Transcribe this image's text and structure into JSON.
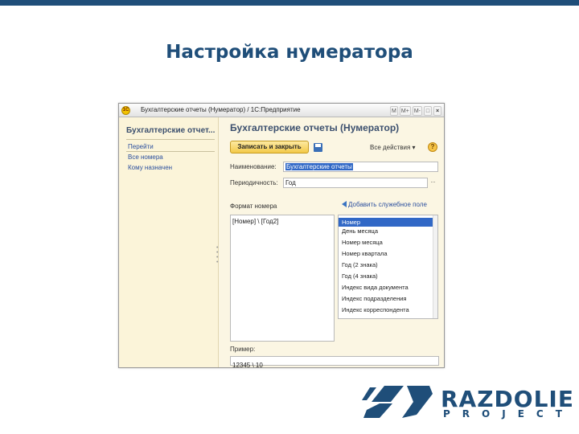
{
  "slide": {
    "title": "Настройка нумератора"
  },
  "window": {
    "title": "Бухгалтерские отчеты (Нумератор) / 1С:Предприятие",
    "app_icon_text": "1С",
    "toolbar": [
      "M",
      "M+",
      "M-",
      "□",
      "×"
    ]
  },
  "sidebar": {
    "heading": "Бухгалтерские отчет...",
    "links": [
      "Перейти",
      "Все номера",
      "Кому назначен"
    ]
  },
  "form": {
    "title": "Бухгалтерские отчеты (Нумератор)",
    "save_close_label": "Записать и закрыть",
    "actions_label": "Все действия ▾",
    "help_label": "?",
    "name_label": "Наименование:",
    "name_value": "Бухгалтерские отчеты",
    "period_label": "Периодичность:",
    "period_value": "Год",
    "period_button": "...",
    "format_label": "Формат номера",
    "add_field_label": "Добавить служебное поле",
    "format_value": "[Номер] \\ [Год2]",
    "service_fields": [
      "Номер",
      "День месяца",
      "Номер месяца",
      "Номер квартала",
      "Год (2 знака)",
      "Год (4 знака)",
      "Индекс вида документа",
      "Индекс подразделения",
      "Индекс корреспондента"
    ],
    "selected_field_index": 0,
    "example_label": "Пример:",
    "example_value": "12345 \\ 10"
  },
  "logo": {
    "name": "RAZDOLIE",
    "sub": "PROJECT",
    "color": "#1f4e79"
  }
}
